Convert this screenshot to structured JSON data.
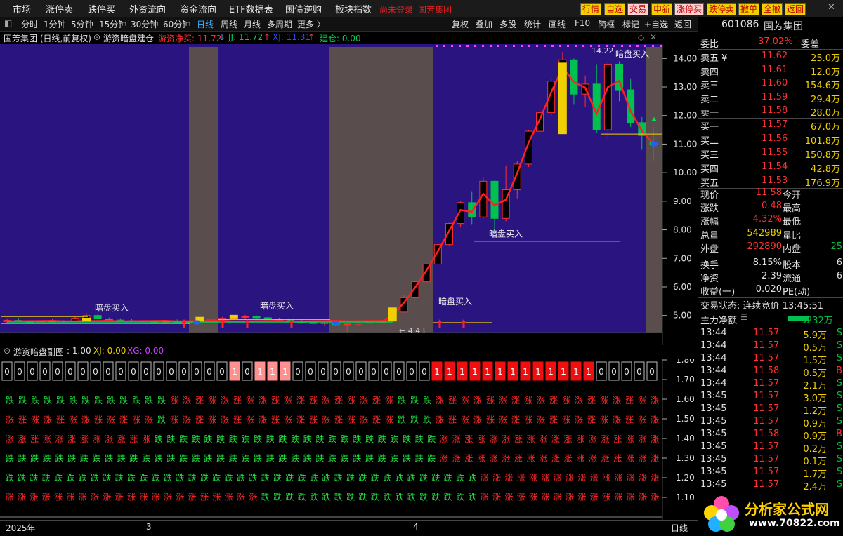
{
  "top_menu": {
    "items": [
      "市场",
      "涨停卖",
      "跌停买",
      "外资流向",
      "资金流向",
      "ETF数据表",
      "国债逆购",
      "板块指数"
    ],
    "status": "尚未登录",
    "stock_label": "国芳集团",
    "buttons": [
      "行情",
      "自选",
      "交易",
      "申新",
      "涨停买",
      "跌停卖",
      "撤单",
      "全撤",
      "返回"
    ]
  },
  "period_bar": {
    "tabs": [
      "分时",
      "1分钟",
      "5分钟",
      "15分钟",
      "30分钟",
      "60分钟",
      "日线",
      "周线",
      "月线",
      "多周期",
      "更多 〉"
    ],
    "active": "日线",
    "tools": [
      "复权",
      "叠加",
      "多股",
      "统计",
      "画线",
      "F10",
      "简框",
      "标记",
      "+自选",
      "返回"
    ]
  },
  "chart_header": {
    "title": "国芳集团 (日线,前复权)",
    "indicator": "游资暗盘建仓",
    "items": [
      {
        "label": "游资净买: 11.72",
        "arrow": "↓",
        "color": "#ff3030"
      },
      {
        "label": "JJ: 11.72",
        "arrow": "↑",
        "color": "#00d050"
      },
      {
        "label": "XJ: 11.31",
        "arrow": "↑",
        "color": "#3050ff"
      },
      {
        "label": "建仓: 0.00",
        "arrow": "",
        "color": "#00d050"
      }
    ]
  },
  "sub_header": {
    "indicator": "游资暗盘副图",
    "value": ": 1.00",
    "xj": "XJ: 0.00",
    "xg": "XG: 0.00"
  },
  "chart_data": {
    "type": "candlestick",
    "y_ticks": [
      "14.00",
      "13.00",
      "12.00",
      "11.00",
      "10.00",
      "9.00",
      "8.00",
      "7.00",
      "6.00",
      "5.00"
    ],
    "ylim": [
      4.55,
      14.4
    ],
    "candles": [
      {
        "o": 4.78,
        "h": 4.9,
        "l": 4.7,
        "c": 4.83
      },
      {
        "o": 4.83,
        "h": 4.92,
        "l": 4.75,
        "c": 4.8
      },
      {
        "o": 4.8,
        "h": 4.86,
        "l": 4.7,
        "c": 4.74
      },
      {
        "o": 4.74,
        "h": 4.82,
        "l": 4.68,
        "c": 4.79
      },
      {
        "o": 4.79,
        "h": 4.88,
        "l": 4.75,
        "c": 4.77
      },
      {
        "o": 4.77,
        "h": 4.84,
        "l": 4.72,
        "c": 4.81
      },
      {
        "o": 4.81,
        "h": 4.95,
        "l": 4.78,
        "c": 4.9
      },
      {
        "o": 4.9,
        "h": 5.08,
        "l": 4.86,
        "c": 5.0
      },
      {
        "o": 5.0,
        "h": 5.05,
        "l": 4.85,
        "c": 4.88
      },
      {
        "o": 4.88,
        "h": 4.93,
        "l": 4.8,
        "c": 4.84
      },
      {
        "o": 4.84,
        "h": 4.9,
        "l": 4.78,
        "c": 4.82
      },
      {
        "o": 4.82,
        "h": 4.87,
        "l": 4.76,
        "c": 4.8
      },
      {
        "o": 4.8,
        "h": 4.85,
        "l": 4.74,
        "c": 4.78
      },
      {
        "o": 4.78,
        "h": 4.84,
        "l": 4.72,
        "c": 4.76
      },
      {
        "o": 4.76,
        "h": 4.82,
        "l": 4.7,
        "c": 4.79
      },
      {
        "o": 4.79,
        "h": 4.86,
        "l": 4.74,
        "c": 4.75
      },
      {
        "o": 4.75,
        "h": 4.8,
        "l": 4.7,
        "c": 4.78
      },
      {
        "o": 4.78,
        "h": 4.86,
        "l": 4.75,
        "c": 4.83
      },
      {
        "o": 4.83,
        "h": 4.9,
        "l": 4.78,
        "c": 4.86
      },
      {
        "o": 4.86,
        "h": 4.95,
        "l": 4.82,
        "c": 4.9
      },
      {
        "o": 4.9,
        "h": 4.98,
        "l": 4.85,
        "c": 4.94
      },
      {
        "o": 4.94,
        "h": 5.02,
        "l": 4.88,
        "c": 4.96
      },
      {
        "o": 4.96,
        "h": 5.0,
        "l": 4.88,
        "c": 4.92
      },
      {
        "o": 4.92,
        "h": 4.96,
        "l": 4.84,
        "c": 4.88
      },
      {
        "o": 4.88,
        "h": 4.92,
        "l": 4.8,
        "c": 4.85
      },
      {
        "o": 4.85,
        "h": 4.88,
        "l": 4.78,
        "c": 4.8
      },
      {
        "o": 4.8,
        "h": 4.85,
        "l": 4.72,
        "c": 4.76
      },
      {
        "o": 4.76,
        "h": 4.8,
        "l": 4.68,
        "c": 4.72
      },
      {
        "o": 4.72,
        "h": 4.78,
        "l": 4.65,
        "c": 4.74
      },
      {
        "o": 4.74,
        "h": 4.78,
        "l": 4.62,
        "c": 4.68
      },
      {
        "o": 4.68,
        "h": 4.74,
        "l": 4.43,
        "c": 4.7
      },
      {
        "o": 4.7,
        "h": 4.76,
        "l": 4.64,
        "c": 4.73
      },
      {
        "o": 4.73,
        "h": 4.8,
        "l": 4.68,
        "c": 4.76
      },
      {
        "o": 4.76,
        "h": 4.82,
        "l": 4.7,
        "c": 4.79
      },
      {
        "o": 4.79,
        "h": 5.15,
        "l": 4.78,
        "c": 5.12
      },
      {
        "o": 5.12,
        "h": 5.72,
        "l": 5.1,
        "c": 5.62
      },
      {
        "o": 5.62,
        "h": 6.2,
        "l": 5.6,
        "c": 6.18
      },
      {
        "o": 6.18,
        "h": 6.82,
        "l": 6.15,
        "c": 6.8
      },
      {
        "o": 6.8,
        "h": 7.5,
        "l": 6.78,
        "c": 7.48
      },
      {
        "o": 7.48,
        "h": 8.25,
        "l": 7.45,
        "c": 8.22
      },
      {
        "o": 8.22,
        "h": 9.0,
        "l": 8.1,
        "c": 8.95
      },
      {
        "o": 8.95,
        "h": 9.35,
        "l": 8.2,
        "c": 8.45
      },
      {
        "o": 8.45,
        "h": 9.85,
        "l": 8.4,
        "c": 9.7
      },
      {
        "o": 9.7,
        "h": 9.72,
        "l": 7.85,
        "c": 8.4
      },
      {
        "o": 8.4,
        "h": 10.25,
        "l": 8.3,
        "c": 9.4
      },
      {
        "o": 9.4,
        "h": 10.4,
        "l": 9.1,
        "c": 10.3
      },
      {
        "o": 10.3,
        "h": 11.5,
        "l": 10.2,
        "c": 11.45
      },
      {
        "o": 11.45,
        "h": 12.6,
        "l": 11.3,
        "c": 12.1
      },
      {
        "o": 12.1,
        "h": 13.3,
        "l": 12.0,
        "c": 13.2
      },
      {
        "o": 13.2,
        "h": 14.22,
        "l": 12.8,
        "c": 13.95
      },
      {
        "o": 13.95,
        "h": 14.0,
        "l": 12.4,
        "c": 12.75
      },
      {
        "o": 12.75,
        "h": 13.4,
        "l": 12.3,
        "c": 13.1
      },
      {
        "o": 13.1,
        "h": 13.8,
        "l": 11.4,
        "c": 11.5
      },
      {
        "o": 11.5,
        "h": 13.9,
        "l": 11.2,
        "c": 13.8
      },
      {
        "o": 13.8,
        "h": 13.9,
        "l": 12.5,
        "c": 12.9
      },
      {
        "o": 12.9,
        "h": 13.3,
        "l": 11.6,
        "c": 11.75
      },
      {
        "o": 11.75,
        "h": 11.95,
        "l": 10.8,
        "c": 11.3
      },
      {
        "o": 11.05,
        "h": 11.6,
        "l": 10.4,
        "c": 11.0
      }
    ],
    "annotations": [
      "暗盘买入",
      "暗盘买入",
      "暗盘买入",
      "暗盘买入",
      "暗盘买入"
    ],
    "high_label": "14.22",
    "low_label": "← 4.43",
    "sub_y_ticks": [
      "1.80",
      "1.70",
      "1.60",
      "1.50",
      "1.40",
      "1.30",
      "1.20",
      "1.10"
    ],
    "sub_boxes": [
      "0",
      "0",
      "0",
      "0",
      "0",
      "0",
      "0",
      "0",
      "0",
      "0",
      "0",
      "0",
      "0",
      "0",
      "0",
      "0",
      "0",
      "0",
      "1",
      "0",
      "1",
      "1",
      "1",
      "0",
      "0",
      "0",
      "0",
      "0",
      "0",
      "0",
      "0",
      "0",
      "0",
      "0",
      "1",
      "1",
      "1",
      "1",
      "1",
      "1",
      "1",
      "1",
      "1",
      "1",
      "1",
      "1",
      "1",
      "0",
      "0",
      "0",
      "0",
      "0"
    ],
    "sub_rows": [
      "跌跌跌跌跌跌跌跌跌跌跌跌跌涨涨涨涨涨涨涨涨涨涨涨涨涨涨涨涨涨涨跌跌跌涨涨涨涨涨涨涨涨涨涨涨涨涨涨涨涨涨涨",
      "涨涨涨涨涨涨涨涨涨涨涨涨跌涨涨涨涨涨涨涨涨涨涨涨涨涨涨涨涨涨涨跌跌跌涨涨涨涨涨涨涨涨涨涨涨涨涨涨涨涨涨涨",
      "涨涨涨涨涨涨涨涨涨涨涨涨跌跌跌跌跌跌跌跌跌跌跌跌跌跌跌跌跌跌跌跌跌跌跌涨涨涨涨涨涨涨涨涨涨涨涨涨涨涨涨涨涨",
      "跌跌跌跌跌跌跌跌跌跌跌跌跌跌跌跌跌跌跌跌跌跌跌跌跌跌跌跌跌跌跌跌跌跌跌涨涨涨涨涨涨涨涨涨涨涨涨涨涨涨涨涨涨",
      "跌跌跌跌跌跌跌跌跌跌跌跌跌跌跌跌跌跌跌跌跌跌跌跌跌跌跌跌跌跌跌跌跌跌跌跌跌跌跌涨涨涨涨涨涨涨涨涨涨涨涨涨涨涨",
      "涨涨涨涨涨涨涨涨涨涨涨涨涨涨涨涨涨涨涨涨涨跌跌跌跌跌跌跌跌跌跌跌跌跌跌跌跌跌跌涨涨涨涨涨涨涨涨涨涨涨涨涨涨涨"
    ]
  },
  "bottom_bar": {
    "year": "2025年",
    "m3": "3",
    "m4": "4",
    "period": "日线"
  },
  "quote": {
    "code": "601086",
    "name": "国芳集团",
    "weibi_label": "委比",
    "weibi": "37.02%",
    "weicha_label": "委差",
    "asks": [
      {
        "label": "卖五 ¥",
        "price": "11.62",
        "vol": "25.0万"
      },
      {
        "label": "卖四",
        "price": "11.61",
        "vol": "12.0万"
      },
      {
        "label": "卖三",
        "price": "11.60",
        "vol": "154.6万"
      },
      {
        "label": "卖二",
        "price": "11.59",
        "vol": "29.4万"
      },
      {
        "label": "卖一",
        "price": "11.58",
        "vol": "28.0万"
      }
    ],
    "bids": [
      {
        "label": "买一",
        "price": "11.57",
        "vol": "67.0万"
      },
      {
        "label": "买二",
        "price": "11.56",
        "vol": "101.8万"
      },
      {
        "label": "买三",
        "price": "11.55",
        "vol": "150.8万"
      },
      {
        "label": "买四",
        "price": "11.54",
        "vol": "42.8万"
      },
      {
        "label": "买五",
        "price": "11.53",
        "vol": "176.9万"
      }
    ],
    "stats": [
      {
        "l": "现价",
        "v": "11.58",
        "c": "#ff3030",
        "l2": "今开",
        "v2": ""
      },
      {
        "l": "涨跌",
        "v": "0.48",
        "c": "#ff3030",
        "l2": "最高",
        "v2": ""
      },
      {
        "l": "涨幅",
        "v": "4.32%",
        "c": "#ff3030",
        "l2": "最低",
        "v2": ""
      },
      {
        "l": "总量",
        "v": "542989",
        "c": "#f0d000",
        "l2": "量比",
        "v2": ""
      },
      {
        "l": "外盘",
        "v": "292890",
        "c": "#ff3030",
        "l2": "内盘",
        "v2": "25"
      }
    ],
    "stats2": [
      {
        "l": "换手",
        "v": "8.15%",
        "l2": "股本",
        "v2": "6"
      },
      {
        "l": "净资",
        "v": "2.39",
        "l2": "流通",
        "v2": "6"
      },
      {
        "l": "收益(一)",
        "v": "0.020",
        "l2": "PE(动)",
        "v2": ""
      }
    ],
    "trade_state": "交易状态: 连续竞价 13:45:51",
    "main_flow_label": "主力净额",
    "main_flow": "-3232万",
    "ticks": [
      {
        "t": "13:44",
        "p": "11.57",
        "v": "5.9万",
        "s": "S"
      },
      {
        "t": "13:44",
        "p": "11.57",
        "v": "0.5万",
        "s": "S"
      },
      {
        "t": "13:44",
        "p": "11.57",
        "v": "1.5万",
        "s": "S"
      },
      {
        "t": "13:44",
        "p": "11.58",
        "v": "0.5万",
        "s": "B"
      },
      {
        "t": "13:44",
        "p": "11.57",
        "v": "2.1万",
        "s": "S"
      },
      {
        "t": "13:45",
        "p": "11.57",
        "v": "3.0万",
        "s": "S"
      },
      {
        "t": "13:45",
        "p": "11.57",
        "v": "1.2万",
        "s": "S"
      },
      {
        "t": "13:45",
        "p": "11.57",
        "v": "0.9万",
        "s": "S"
      },
      {
        "t": "13:45",
        "p": "11.58",
        "v": "0.9万",
        "s": "B"
      },
      {
        "t": "13:45",
        "p": "11.57",
        "v": "0.2万",
        "s": "S"
      },
      {
        "t": "13:45",
        "p": "11.57",
        "v": "0.1万",
        "s": "S"
      },
      {
        "t": "13:45",
        "p": "11.57",
        "v": "1.7万",
        "s": "S"
      },
      {
        "t": "13:45",
        "p": "11.57",
        "v": "2.4万",
        "s": "S"
      }
    ],
    "watermark_text": "分析家公式网",
    "watermark_url": "www.70822.com"
  },
  "colors": {
    "purple": "#2a1580",
    "gray": "#5a4d4d",
    "up": "#ff3030",
    "down": "#00c050",
    "yellow": "#f0d000"
  }
}
